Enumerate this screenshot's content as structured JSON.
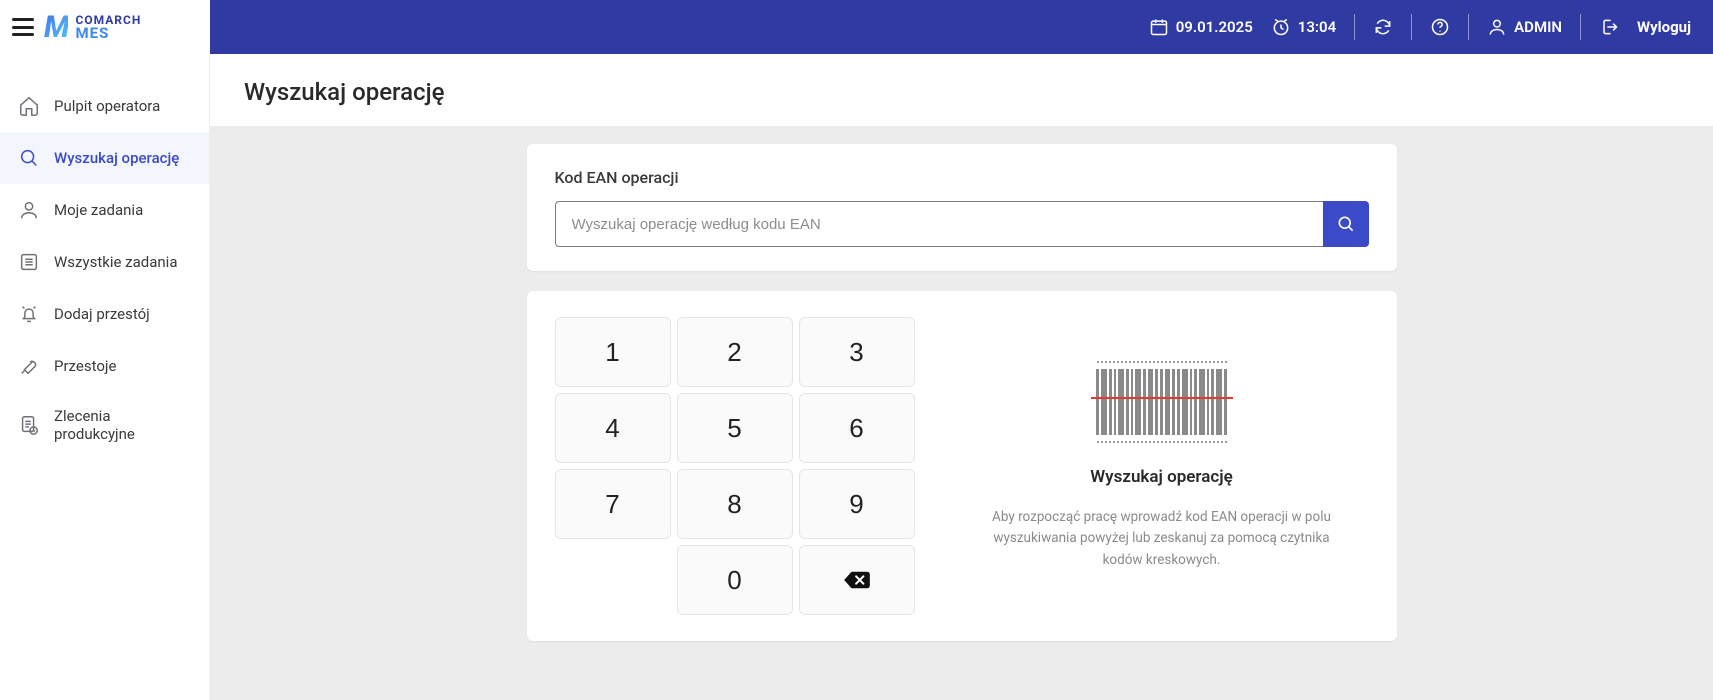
{
  "header": {
    "brand_top": "COMARCH",
    "brand_bottom": "MES",
    "date": "09.01.2025",
    "time": "13:04",
    "user": "ADMIN",
    "logout": "Wyloguj"
  },
  "sidebar": {
    "items": [
      {
        "label": "Pulpit operatora"
      },
      {
        "label": "Wyszukaj operację"
      },
      {
        "label": "Moje zadania"
      },
      {
        "label": "Wszystkie zadania"
      },
      {
        "label": "Dodaj przestój"
      },
      {
        "label": "Przestoje"
      },
      {
        "label": "Zlecenia produkcyjne"
      }
    ],
    "active_index": 1
  },
  "page": {
    "title": "Wyszukaj operację",
    "search_label": "Kod EAN operacji",
    "search_placeholder": "Wyszukaj operację według kodu EAN",
    "search_value": "",
    "keypad": [
      "1",
      "2",
      "3",
      "4",
      "5",
      "6",
      "7",
      "8",
      "9",
      "0"
    ],
    "hint_title": "Wyszukaj operację",
    "hint_text": "Aby rozpocząć pracę wprowadź kod EAN operacji w polu wyszukiwania powyżej lub zeskanuj za pomocą czytnika kodów kreskowych."
  },
  "colors": {
    "primary": "#2f3ba3",
    "accent": "#3b4ac8"
  }
}
